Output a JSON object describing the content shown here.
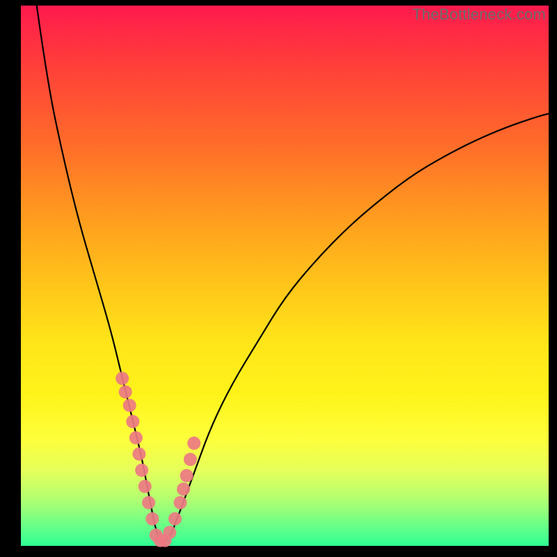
{
  "watermark": "TheBottleneck.com",
  "chart_data": {
    "type": "line",
    "title": "",
    "xlabel": "",
    "ylabel": "",
    "xlim": [
      0,
      100
    ],
    "ylim": [
      0,
      100
    ],
    "series": [
      {
        "name": "curve",
        "x": [
          3,
          5,
          8,
          11,
          14,
          17,
          19,
          21,
          23,
          24.5,
          26,
          28,
          30,
          33,
          36,
          40,
          45,
          50,
          56,
          62,
          68,
          74,
          80,
          86,
          92,
          98,
          100
        ],
        "y": [
          100,
          86,
          72,
          60,
          50,
          40,
          32,
          24,
          16,
          8,
          1,
          1,
          6,
          14,
          22,
          30,
          38,
          46,
          53,
          59,
          64,
          68.5,
          72,
          75,
          77.5,
          79.5,
          80
        ]
      }
    ],
    "scatter_points": {
      "name": "highlighted",
      "color": "#ed7a83",
      "x": [
        19.2,
        19.8,
        20.6,
        21.2,
        21.8,
        22.4,
        22.9,
        23.5,
        24.2,
        24.9,
        25.6,
        26.4,
        27.3,
        28.2,
        29.2,
        30.2,
        30.8,
        31.4,
        32.1,
        32.8
      ],
      "y": [
        31,
        28.5,
        26,
        23,
        20,
        17,
        14,
        11,
        8,
        5,
        2,
        1,
        1,
        2.5,
        5,
        8,
        10.5,
        13,
        16,
        19
      ]
    }
  }
}
